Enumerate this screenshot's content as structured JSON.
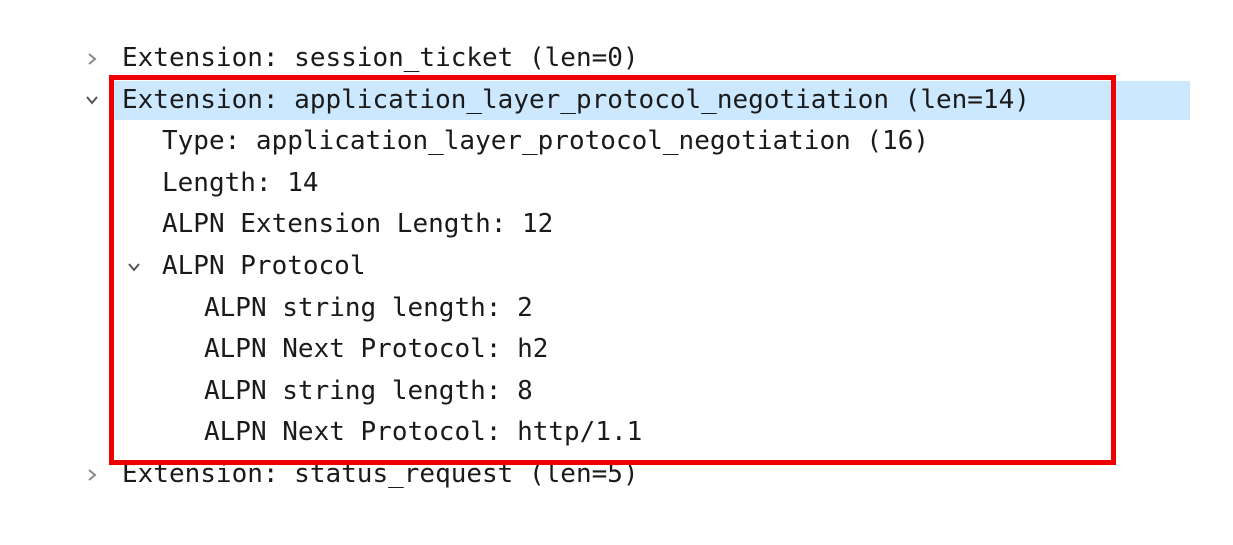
{
  "tree": {
    "rows": [
      {
        "text": "Extension: session_ticket (len=0)",
        "state": "collapsed"
      },
      {
        "text": "Extension: application_layer_protocol_negotiation (len=14)",
        "state": "expanded",
        "selected": true
      },
      {
        "text": "Type: application_layer_protocol_negotiation (16)"
      },
      {
        "text": "Length: 14"
      },
      {
        "text": "ALPN Extension Length: 12"
      },
      {
        "text": "ALPN Protocol",
        "state": "expanded"
      },
      {
        "text": "ALPN string length: 2"
      },
      {
        "text": "ALPN Next Protocol: h2"
      },
      {
        "text": "ALPN string length: 8"
      },
      {
        "text": "ALPN Next Protocol: http/1.1"
      },
      {
        "text": "Extension: status_request (len=5)",
        "state": "collapsed"
      }
    ]
  },
  "colors": {
    "selection": "#cce8ff",
    "highlight_border": "#ee0000",
    "chevron": "#8a8a8a",
    "text": "#1a1a1a"
  },
  "icons": {
    "collapsed": "chevron-right-icon",
    "expanded": "chevron-down-icon"
  }
}
